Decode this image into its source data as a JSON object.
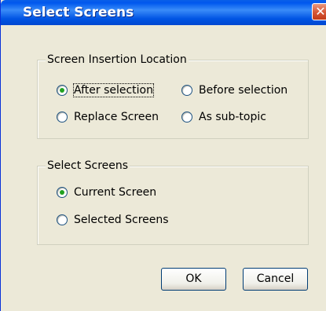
{
  "window": {
    "title": "Select Screens",
    "close_glyph": "✕"
  },
  "insertion_group": {
    "label": "Screen Insertion Location",
    "options": [
      {
        "label": "After selection",
        "checked": true
      },
      {
        "label": "Before selection",
        "checked": false
      },
      {
        "label": "Replace Screen",
        "checked": false
      },
      {
        "label": "As sub-topic",
        "checked": false
      }
    ]
  },
  "screens_group": {
    "label": "Select Screens",
    "options": [
      {
        "label": "Current Screen",
        "checked": true
      },
      {
        "label": "Selected Screens",
        "checked": false
      }
    ]
  },
  "buttons": {
    "ok": "OK",
    "cancel": "Cancel"
  }
}
